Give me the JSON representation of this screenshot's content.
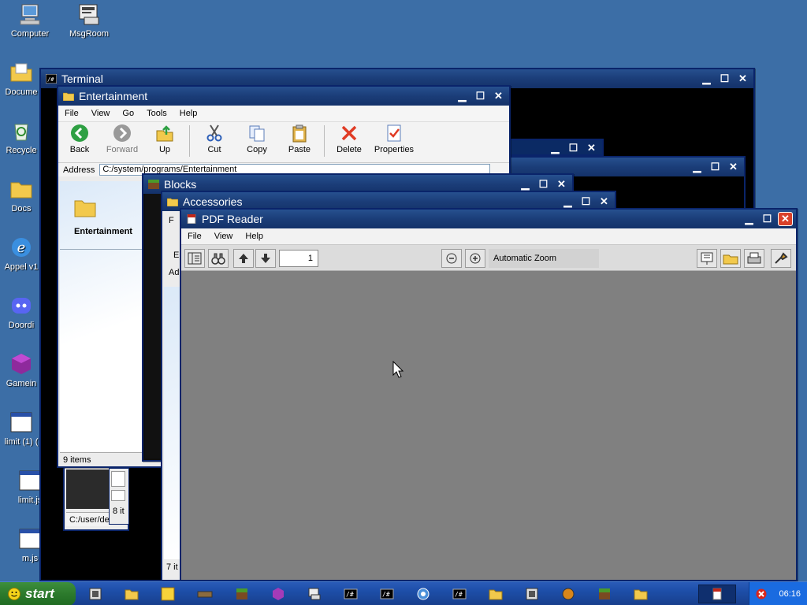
{
  "desktop_icons": [
    {
      "label": "Computer",
      "icon": "computer-icon"
    },
    {
      "label": "MsgRoom",
      "icon": "msgroom-icon"
    },
    {
      "label": "Docume",
      "icon": "documents-folder-icon"
    },
    {
      "label": "Recycle",
      "icon": "recycle-bin-icon"
    },
    {
      "label": "Docs",
      "icon": "folder-icon"
    },
    {
      "label": "Appel v1",
      "icon": "browser-icon"
    },
    {
      "label": "Doordi",
      "icon": "discord-icon"
    },
    {
      "label": "Gamein",
      "icon": "game-cube-icon"
    },
    {
      "label": "limit (1) (",
      "icon": "js-file-icon"
    },
    {
      "label": "limit.js",
      "icon": "js-file-icon"
    },
    {
      "label": "m.js",
      "icon": "js-file-icon"
    }
  ],
  "terminal": {
    "title": "Terminal"
  },
  "entertainment": {
    "title": "Entertainment",
    "menu": [
      "File",
      "View",
      "Go",
      "Tools",
      "Help"
    ],
    "toolbar": {
      "back": "Back",
      "forward": "Forward",
      "up": "Up",
      "cut": "Cut",
      "copy": "Copy",
      "paste": "Paste",
      "delete": "Delete",
      "properties": "Properties"
    },
    "address_label": "Address",
    "address_value": "C:/system/programs/Entertainment",
    "side_folder_label": "Entertainment",
    "status": "9 items"
  },
  "behind_windows": {
    "path_fragment": "C:/user/de",
    "items_8": "8 it",
    "items_7": "7 it",
    "fragment_f": "F",
    "fragment_e": "E",
    "fragment_ad": "Ad"
  },
  "blocks": {
    "title": "Blocks"
  },
  "accessories": {
    "title": "Accessories"
  },
  "pdf_reader": {
    "title": "PDF Reader",
    "menu": [
      "File",
      "View",
      "Help"
    ],
    "page_number": "1",
    "zoom": "Automatic Zoom"
  },
  "taskbar": {
    "start_label": "start",
    "clock": "06:16"
  },
  "colors": {
    "desktop": "#3c6ea6",
    "title_bar": "#1b3d78",
    "pdf_canvas": "#808080",
    "taskbar": "#1d4ea8",
    "start": "#2c7a2c"
  }
}
